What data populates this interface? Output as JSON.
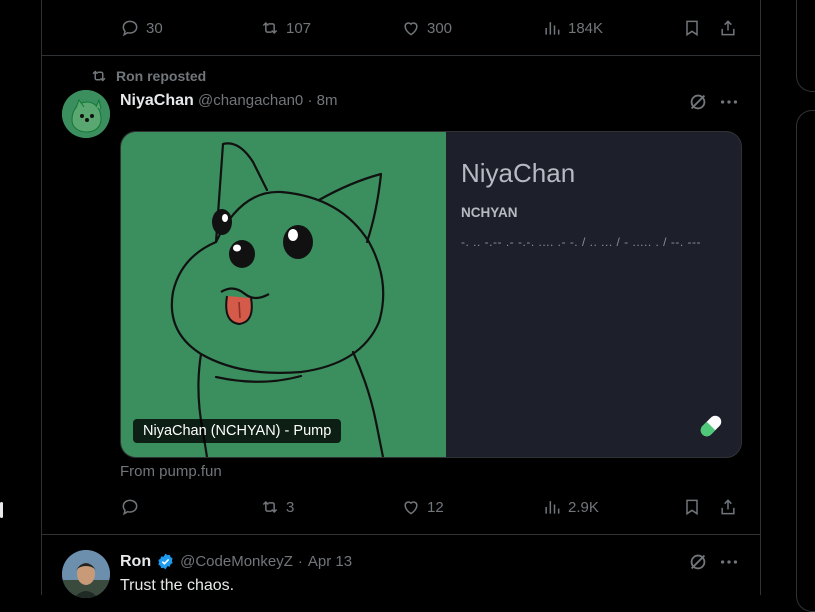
{
  "top_tweet": {
    "actions": {
      "replies": "30",
      "reposts": "107",
      "likes": "300",
      "views": "184K"
    }
  },
  "tweet1": {
    "repost_label": "Ron reposted",
    "display_name": "NiyaChan",
    "handle": "@changachan0",
    "separator": "·",
    "time": "8m",
    "card": {
      "title": "NiyaChan",
      "symbol": "NCHYAN",
      "morse": "-. .. -.-- .- -.-. .... .- -. / .. ... / - ..... . / --. ---",
      "tag": "NiyaChan (NCHYAN) - Pump",
      "background_color": "#3b8f5e"
    },
    "source": "From pump.fun",
    "actions": {
      "replies": "",
      "reposts": "3",
      "likes": "12",
      "views": "2.9K"
    }
  },
  "tweet2": {
    "display_name": "Ron",
    "handle": "@CodeMonkeyZ",
    "separator": "·",
    "time": "Apr 13",
    "text": "Trust the chaos.",
    "verified_color": "#1d9bf0"
  }
}
